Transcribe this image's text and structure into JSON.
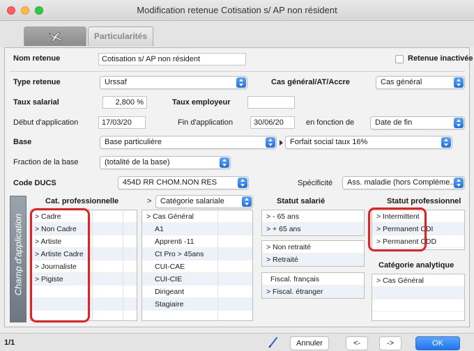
{
  "window": {
    "title": "Modification retenue Cotisation s/ AP non résident"
  },
  "tabs": {
    "first_icon": "airplane-icon",
    "second_label": "Particularités"
  },
  "form": {
    "nom_retenue": {
      "label": "Nom retenue",
      "value": "Cotisation s/ AP non résident"
    },
    "retenue_inactivee": {
      "label": "Retenue inactivée",
      "checked": false
    },
    "type_retenue": {
      "label": "Type retenue",
      "value": "Urssaf"
    },
    "cas_general": {
      "label": "Cas général/AT/Accre",
      "value": "Cas général"
    },
    "taux_salarial": {
      "label": "Taux salarial",
      "value": "2,800 %"
    },
    "taux_employeur": {
      "label": "Taux employeur",
      "value": ""
    },
    "debut_application": {
      "label": "Début d'application",
      "value": "17/03/20"
    },
    "fin_application": {
      "label": "Fin d'application",
      "value": "30/06/20"
    },
    "en_fonction_de": {
      "label": "en fonction de",
      "value": "Date de fin"
    },
    "base": {
      "label": "Base",
      "value": "Base particulière",
      "detail": "Forfait social taux 16%"
    },
    "fraction_base": {
      "label": "Fraction de la base",
      "value": "(totalité de la base)"
    },
    "code_ducs": {
      "label": "Code DUCS",
      "value": "454D  RR CHOM.NON RES"
    },
    "specificite": {
      "label": "Spécificité",
      "value": "Ass. maladie (hors Compléme..."
    }
  },
  "champ": {
    "sidebar_label": "Champ d'application",
    "cat_pro": {
      "header": "Cat. professionnelle",
      "items": [
        "> Cadre",
        "> Non Cadre",
        "> Artiste",
        "> Artiste Cadre",
        "> Journaliste",
        "> Pigiste"
      ]
    },
    "categorie": {
      "prefix": ">",
      "select": "Catégorie salariale",
      "items": [
        "> Cas Général",
        "A1",
        "Apprenti -11",
        "Ct Pro > 45ans",
        "CUI-CAE",
        "CUI-CIE",
        "Dirigeant",
        "Stagiaire"
      ]
    },
    "statut_salarie": {
      "header": "Statut salarié",
      "age": [
        ">  - 65 ans",
        ">  + 65 ans"
      ],
      "retraite": [
        "> Non retraité",
        "> Retraité"
      ],
      "fiscal": [
        "Fiscal. français",
        "> Fiscal. étranger"
      ]
    },
    "statut_pro": {
      "header": "Statut professionnel",
      "items": [
        "> Intermittent",
        "> Permanent CDI",
        "> Permanent CDD"
      ]
    },
    "cat_analytique": {
      "header": "Catégorie analytique",
      "items": [
        "> Cas Général"
      ]
    }
  },
  "footer": {
    "page": "1/1",
    "pen_icon": "pen-icon",
    "cancel": "Annuler",
    "prev": "<-",
    "next": "->",
    "ok": "OK"
  },
  "colors": {
    "accent": "#1f74ec",
    "highlight": "#ee1c1c"
  }
}
